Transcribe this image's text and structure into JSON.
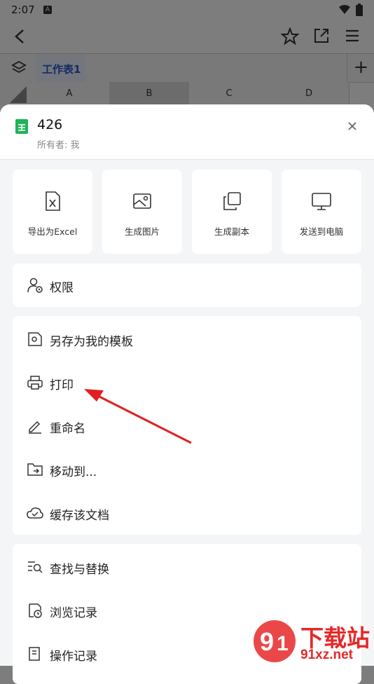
{
  "status_bar": {
    "time": "2:07",
    "notif_letter": "A"
  },
  "sheet_tab": {
    "label": "工作表1",
    "add": "+"
  },
  "columns": [
    "A",
    "B",
    "C",
    "D"
  ],
  "file": {
    "name": "426",
    "owner": "所有者: 我"
  },
  "tiles": [
    {
      "label": "导出为Excel",
      "icon": "excel-file-icon"
    },
    {
      "label": "生成图片",
      "icon": "image-icon"
    },
    {
      "label": "生成副本",
      "icon": "copy-icon"
    },
    {
      "label": "发送到电脑",
      "icon": "monitor-icon"
    }
  ],
  "permission": {
    "label": "权限",
    "icon": "user-permission-icon"
  },
  "menu_group1": [
    {
      "label": "另存为我的模板",
      "icon": "template-icon"
    },
    {
      "label": "打印",
      "icon": "printer-icon"
    },
    {
      "label": "重命名",
      "icon": "pencil-icon"
    },
    {
      "label": "移动到...",
      "icon": "folder-move-icon"
    },
    {
      "label": "缓存该文档",
      "icon": "cloud-check-icon"
    }
  ],
  "menu_group2": [
    {
      "label": "查找与替换",
      "icon": "find-replace-icon"
    },
    {
      "label": "浏览记录",
      "icon": "history-icon"
    },
    {
      "label": "操作记录",
      "icon": "log-icon"
    }
  ],
  "watermark": {
    "text1": "下载站",
    "text2": "91xz.net"
  },
  "colors": {
    "accent": "#2a57c4",
    "sheet_icon": "#1fb45a",
    "arrow": "#e02020"
  }
}
